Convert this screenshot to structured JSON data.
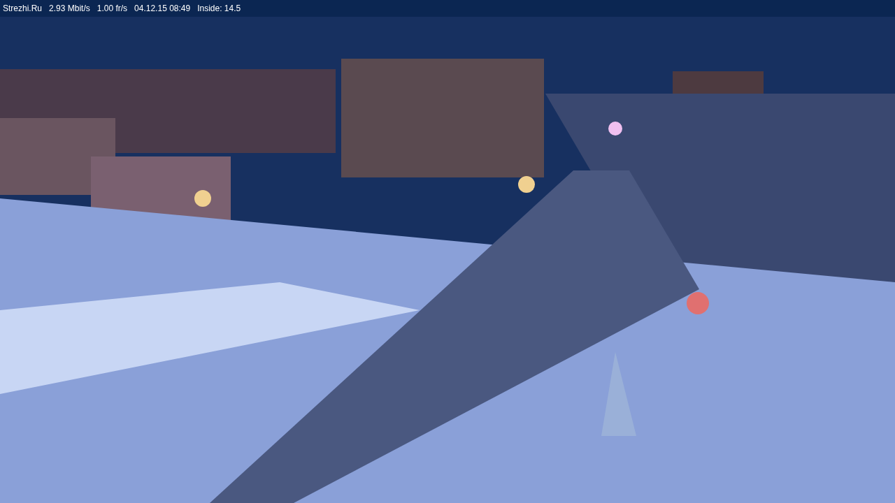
{
  "status_bar": {
    "site": "Strezhi.Ru",
    "bitrate": "2.93 Mbit/s",
    "frame_rate": "1.00 fr/s",
    "timestamp": "04.12.15 08:49",
    "inside": "Inside: 14.5"
  }
}
